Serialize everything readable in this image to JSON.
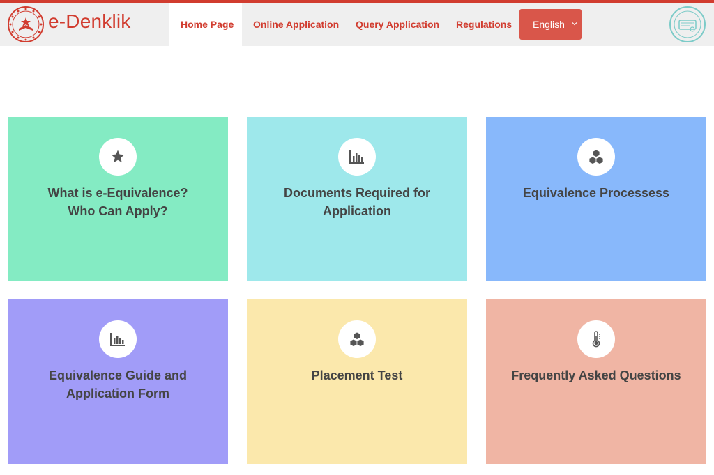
{
  "brand": {
    "name": "e-Denklik"
  },
  "nav": {
    "home": "Home Page",
    "online": "Online Application",
    "query": "Query Application",
    "regulations": "Regulations"
  },
  "language": {
    "selected": "English"
  },
  "colors": {
    "accent": "#d13c2f",
    "language_button": "#d9564a",
    "card_1": "#84ebc3",
    "card_2": "#9ee8eb",
    "card_3": "#88b8fb",
    "card_4": "#a19cf8",
    "card_5": "#fbe8ac",
    "card_6": "#f0b5a4"
  },
  "cards": [
    {
      "icon": "star-icon",
      "title_lines": [
        "What is e-Equivalence?",
        "Who Can Apply?"
      ]
    },
    {
      "icon": "bar-chart-icon",
      "title_lines": [
        "Documents Required for",
        "Application"
      ]
    },
    {
      "icon": "cubes-icon",
      "title_lines": [
        "Equivalence Processess"
      ]
    },
    {
      "icon": "bar-chart-icon",
      "title_lines": [
        "Equivalence Guide and",
        "Application Form"
      ]
    },
    {
      "icon": "cubes-icon",
      "title_lines": [
        "Placement Test"
      ]
    },
    {
      "icon": "thermometer-icon",
      "title_lines": [
        "Frequently Asked Questions"
      ]
    }
  ]
}
